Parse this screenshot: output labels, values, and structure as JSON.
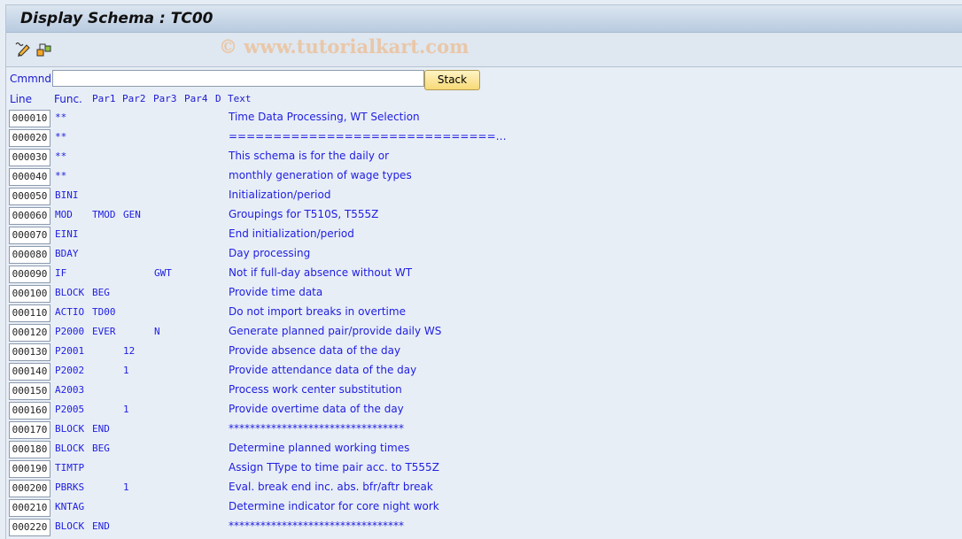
{
  "window": {
    "title": "Display Schema : TC00"
  },
  "toolbar": {
    "icons": [
      "edit-pencil-icon",
      "hierarchy-icon"
    ]
  },
  "watermark": "© www.tutorialkart.com",
  "command": {
    "label": "Cmmnd",
    "value": "",
    "stack_label": "Stack"
  },
  "headers": {
    "line": "Line",
    "func": "Func.",
    "par1": "Par1",
    "par2": "Par2",
    "par3": "Par3",
    "par4": "Par4",
    "d": "D",
    "text": "Text"
  },
  "rows": [
    {
      "line": "000010",
      "func": "**",
      "par1": "",
      "par2": "",
      "par3": "",
      "par4": "",
      "d": "",
      "text": "Time Data Processing, WT Selection"
    },
    {
      "line": "000020",
      "func": "**",
      "par1": "",
      "par2": "",
      "par3": "",
      "par4": "",
      "d": "",
      "text": "==============================…"
    },
    {
      "line": "000030",
      "func": "**",
      "par1": "",
      "par2": "",
      "par3": "",
      "par4": "",
      "d": "",
      "text": "This schema is for the daily or"
    },
    {
      "line": "000040",
      "func": "**",
      "par1": "",
      "par2": "",
      "par3": "",
      "par4": "",
      "d": "",
      "text": "monthly generation of wage types"
    },
    {
      "line": "000050",
      "func": "BINI",
      "par1": "",
      "par2": "",
      "par3": "",
      "par4": "",
      "d": "",
      "text": "Initialization/period"
    },
    {
      "line": "000060",
      "func": "MOD",
      "par1": "TMOD",
      "par2": "GEN",
      "par3": "",
      "par4": "",
      "d": "",
      "text": "Groupings for T510S, T555Z"
    },
    {
      "line": "000070",
      "func": "EINI",
      "par1": "",
      "par2": "",
      "par3": "",
      "par4": "",
      "d": "",
      "text": "End initialization/period"
    },
    {
      "line": "000080",
      "func": "BDAY",
      "par1": "",
      "par2": "",
      "par3": "",
      "par4": "",
      "d": "",
      "text": "Day processing"
    },
    {
      "line": "000090",
      "func": "IF",
      "par1": "",
      "par2": "",
      "par3": "GWT",
      "par4": "",
      "d": "",
      "text": "Not if full-day absence without WT"
    },
    {
      "line": "000100",
      "func": "BLOCK",
      "par1": "BEG",
      "par2": "",
      "par3": "",
      "par4": "",
      "d": "",
      "text": "Provide time data"
    },
    {
      "line": "000110",
      "func": "ACTIO",
      "par1": "TD00",
      "par2": "",
      "par3": "",
      "par4": "",
      "d": "",
      "text": "Do not import breaks in overtime"
    },
    {
      "line": "000120",
      "func": "P2000",
      "par1": "EVER",
      "par2": "",
      "par3": "N",
      "par4": "",
      "d": "",
      "text": "Generate planned pair/provide daily WS"
    },
    {
      "line": "000130",
      "func": "P2001",
      "par1": "",
      "par2": "12",
      "par3": "",
      "par4": "",
      "d": "",
      "text": "Provide absence data of the day"
    },
    {
      "line": "000140",
      "func": "P2002",
      "par1": "",
      "par2": "1",
      "par3": "",
      "par4": "",
      "d": "",
      "text": "Provide attendance data of the day"
    },
    {
      "line": "000150",
      "func": "A2003",
      "par1": "",
      "par2": "",
      "par3": "",
      "par4": "",
      "d": "",
      "text": "Process work center substitution"
    },
    {
      "line": "000160",
      "func": "P2005",
      "par1": "",
      "par2": "1",
      "par3": "",
      "par4": "",
      "d": "",
      "text": "Provide overtime data of the day"
    },
    {
      "line": "000170",
      "func": "BLOCK",
      "par1": "END",
      "par2": "",
      "par3": "",
      "par4": "",
      "d": "",
      "text": "*********************************"
    },
    {
      "line": "000180",
      "func": "BLOCK",
      "par1": "BEG",
      "par2": "",
      "par3": "",
      "par4": "",
      "d": "",
      "text": "Determine planned working times"
    },
    {
      "line": "000190",
      "func": "TIMTP",
      "par1": "",
      "par2": "",
      "par3": "",
      "par4": "",
      "d": "",
      "text": "Assign TType to time pair acc. to T555Z"
    },
    {
      "line": "000200",
      "func": "PBRKS",
      "par1": "",
      "par2": "1",
      "par3": "",
      "par4": "",
      "d": "",
      "text": "Eval. break end inc. abs. bfr/aftr break"
    },
    {
      "line": "000210",
      "func": "KNTAG",
      "par1": "",
      "par2": "",
      "par3": "",
      "par4": "",
      "d": "",
      "text": "Determine indicator for core night work"
    },
    {
      "line": "000220",
      "func": "BLOCK",
      "par1": "END",
      "par2": "",
      "par3": "",
      "par4": "",
      "d": "",
      "text": "*********************************"
    }
  ]
}
